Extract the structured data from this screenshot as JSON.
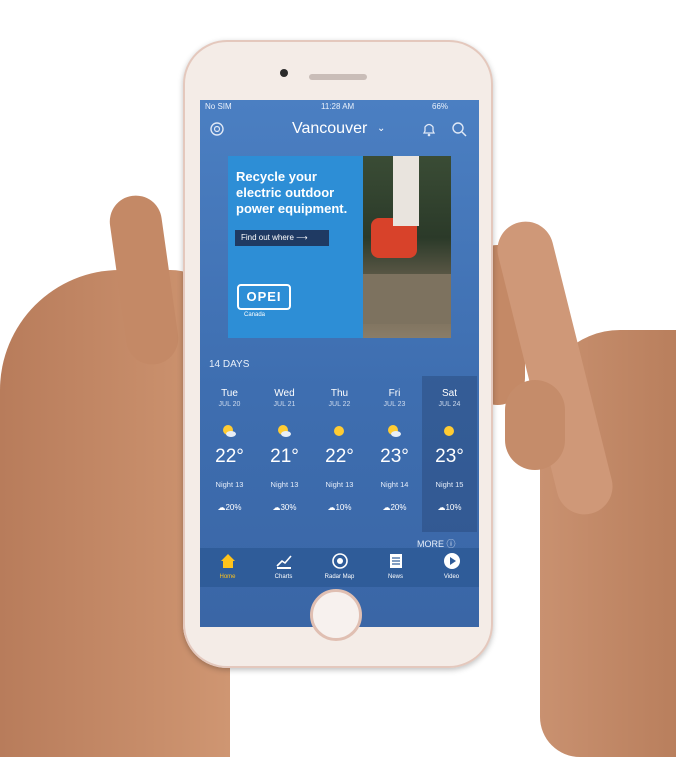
{
  "status_bar": {
    "carrier": "No SIM",
    "time": "11:28 AM",
    "battery": "66%"
  },
  "header": {
    "city": "Vancouver",
    "settings_icon": "gear-icon",
    "alert_icon": "bell-icon",
    "search_icon": "search-icon"
  },
  "ad": {
    "headline": "Recycle your electric outdoor power equipment.",
    "cta": "Find out where ⟶",
    "logo_text": "OPEI",
    "logo_subtext": "Canada"
  },
  "forecast": {
    "label": "14 DAYS",
    "days": [
      {
        "day": "Tue",
        "date": "JUL 20",
        "temp": "22°",
        "night": "Night 13",
        "precip": "20%",
        "icon": "sun-cloud-icon"
      },
      {
        "day": "Wed",
        "date": "JUL 21",
        "temp": "21°",
        "night": "Night 13",
        "precip": "30%",
        "icon": "sun-cloud-icon"
      },
      {
        "day": "Thu",
        "date": "JUL 22",
        "temp": "22°",
        "night": "Night 13",
        "precip": "10%",
        "icon": "sun-icon"
      },
      {
        "day": "Fri",
        "date": "JUL 23",
        "temp": "23°",
        "night": "Night 14",
        "precip": "20%",
        "icon": "sun-cloud-icon"
      },
      {
        "day": "Sat",
        "date": "JUL 24",
        "temp": "23°",
        "night": "Night 15",
        "precip": "10%",
        "icon": "sun-icon"
      }
    ],
    "more": "MORE ⓘ"
  },
  "tabs": [
    {
      "label": "Home",
      "icon": "home-icon",
      "active": true
    },
    {
      "label": "Charts",
      "icon": "chart-icon",
      "active": false
    },
    {
      "label": "Radar Map",
      "icon": "radar-icon",
      "active": false
    },
    {
      "label": "News",
      "icon": "news-icon",
      "active": false
    },
    {
      "label": "Video",
      "icon": "play-icon",
      "active": false
    }
  ],
  "colors": {
    "screen_bg": "#4479bc",
    "tab_bar": "#2f5c99",
    "active_tab": "#ffc31a",
    "ad_bg": "#2d8ed6"
  }
}
